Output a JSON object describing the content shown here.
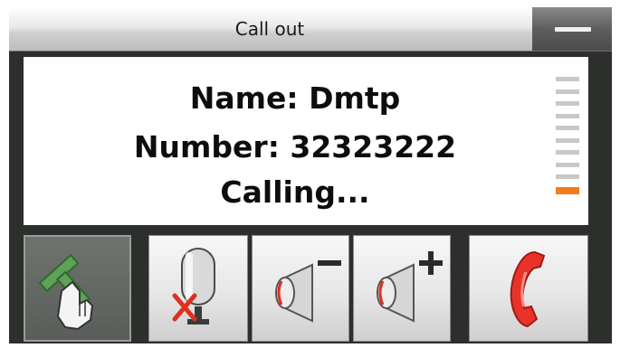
{
  "window": {
    "title": "Call out"
  },
  "call": {
    "name_line": "Name: Dmtp",
    "number_line": "Number: 32323222",
    "status": "Calling..."
  },
  "signal_meter": {
    "segments": 10,
    "level": 1,
    "active_color": "#f47b1e",
    "inactive_color": "#c8c8c8"
  },
  "toolbar": {
    "buttons": [
      {
        "name": "transfer",
        "icon": "hand-pointer-icon"
      },
      {
        "name": "mute",
        "icon": "microphone-muted-icon"
      },
      {
        "name": "volume-down",
        "icon": "speaker-minus-icon"
      },
      {
        "name": "volume-up",
        "icon": "speaker-plus-icon"
      },
      {
        "name": "hang-up",
        "icon": "red-handset-icon"
      }
    ]
  }
}
